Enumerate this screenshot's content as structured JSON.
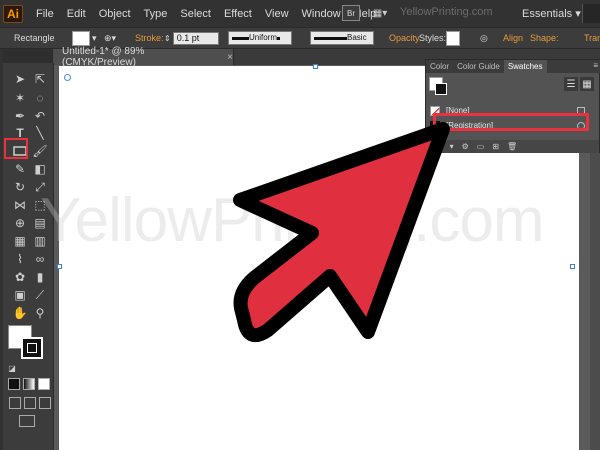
{
  "app": {
    "logo_text": "Ai",
    "menu": [
      "File",
      "Edit",
      "Object",
      "Type",
      "Select",
      "Effect",
      "View",
      "Window",
      "Help"
    ],
    "bridge_label": "Br",
    "watermark_top": "YellowPrinting.com",
    "workspace": "Essentials"
  },
  "control_bar": {
    "tool_name": "Rectangle",
    "stroke_label": "Stroke:",
    "stroke_value": "0.1 pt",
    "profile_label": "Uniform",
    "brush_label": "Basic",
    "opacity_label": "Opacity",
    "styles_label": "Styles:",
    "align_label": "Align",
    "shape_label": "Shape:",
    "transform_label": "Trans"
  },
  "document": {
    "tab_title": "Untitled-1* @ 89% (CMYK/Preview)",
    "close": "×",
    "watermark": "YellowPrinting.com"
  },
  "swatches_panel": {
    "tabs": [
      "Color",
      "Color Guide",
      "Swatches"
    ],
    "active_tab": "Swatches",
    "rows": [
      {
        "name": "[None]",
        "chip": "none"
      },
      {
        "name": "[Registration]",
        "chip": "registration"
      }
    ]
  },
  "colors": {
    "accent_red": "#e8323f",
    "arrow_fill": "#e03040",
    "arrow_outline": "#000000",
    "ui_dark": "#323232",
    "orange_label": "#e89a3c"
  }
}
